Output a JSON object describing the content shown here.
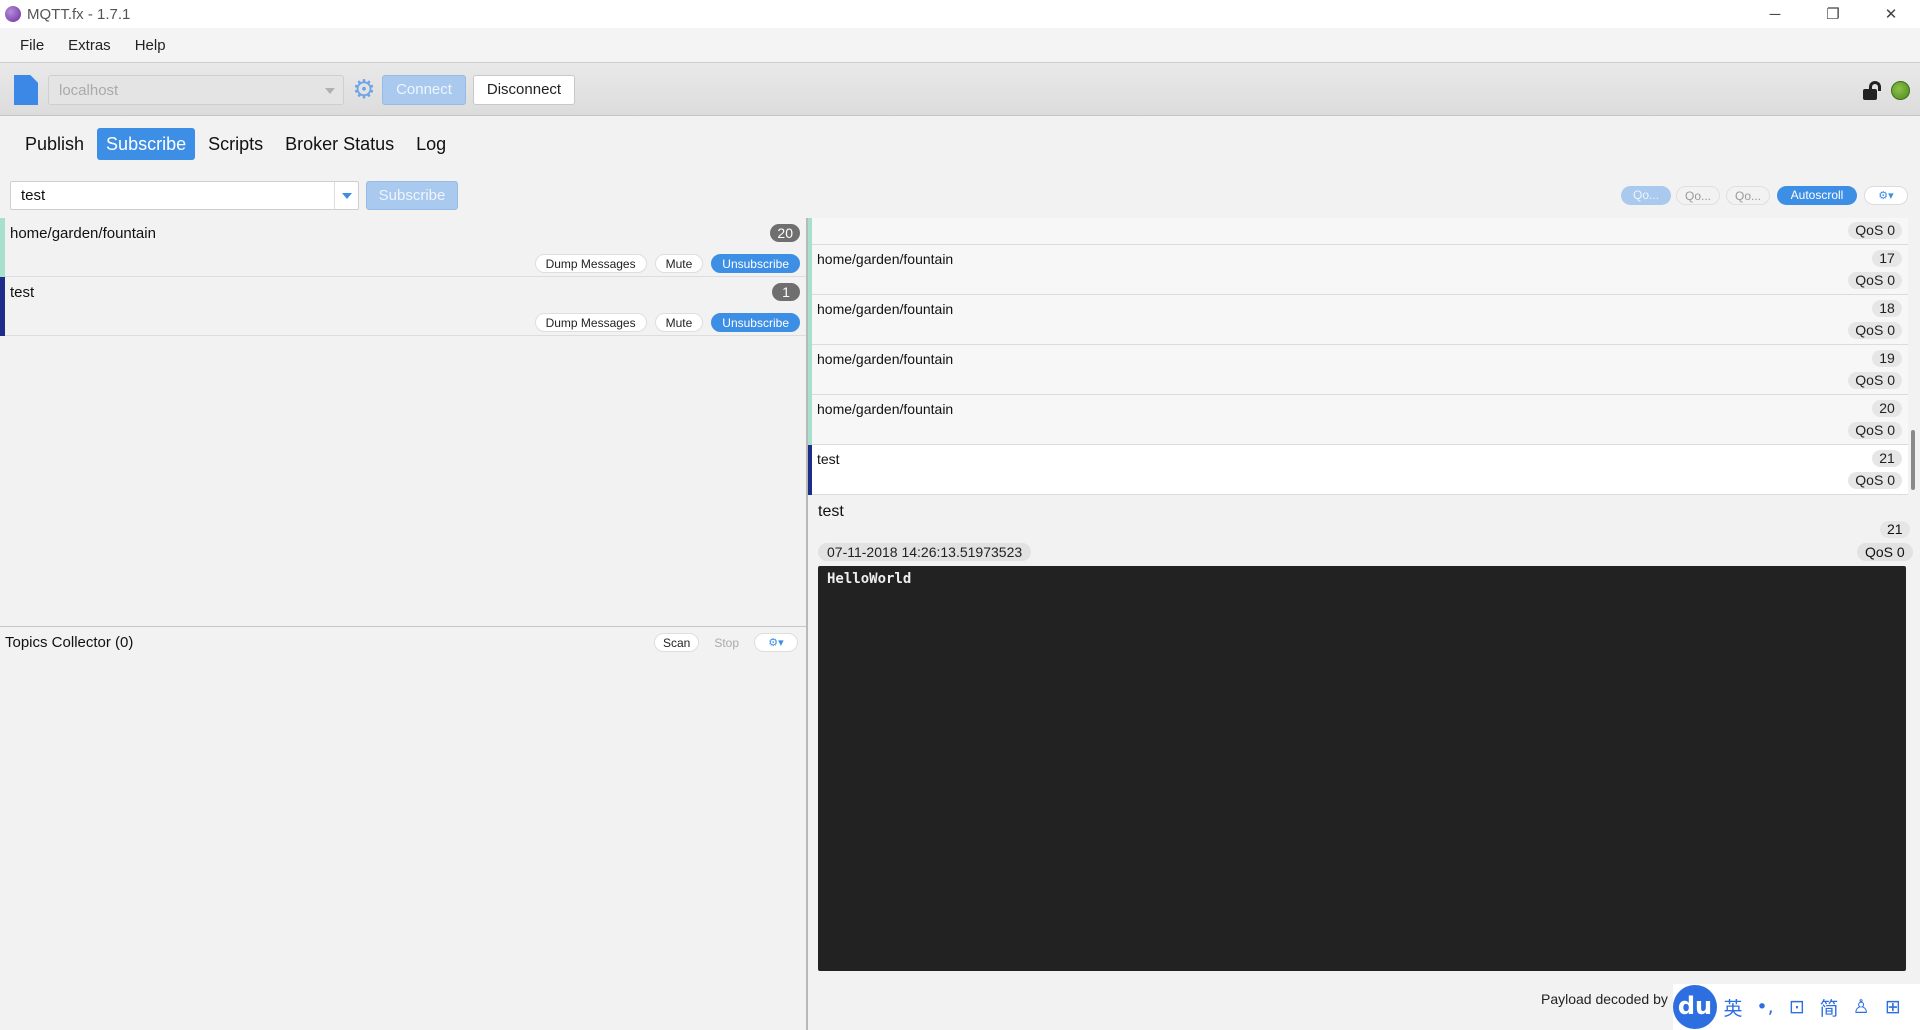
{
  "window": {
    "title": "MQTT.fx - 1.7.1",
    "minimize_glyph": "─",
    "restore_glyph": "❐",
    "close_glyph": "✕"
  },
  "menu": [
    "File",
    "Extras",
    "Help"
  ],
  "toolbar": {
    "broker_profile": "localhost",
    "connect_label": "Connect",
    "disconnect_label": "Disconnect",
    "gear_glyph": "⚙",
    "status_color": "#6aa332"
  },
  "tabs": [
    {
      "label": "Publish",
      "active": false
    },
    {
      "label": "Subscribe",
      "active": true
    },
    {
      "label": "Scripts",
      "active": false
    },
    {
      "label": "Broker Status",
      "active": false
    },
    {
      "label": "Log",
      "active": false
    }
  ],
  "subscribe": {
    "topic_value": "test",
    "subscribe_label": "Subscribe"
  },
  "qos_filters": [
    "Qo...",
    "Qo...",
    "Qo..."
  ],
  "autoscroll_label": "Autoscroll",
  "gears_glyph": "⚙▾",
  "subscriptions": [
    {
      "topic": "home/garden/fountain",
      "count": "20",
      "color": "#a8e0cf",
      "dump": "Dump Messages",
      "mute": "Mute",
      "unsubscribe": "Unsubscribe"
    },
    {
      "topic": "test",
      "count": "1",
      "color": "#1f2d8a",
      "dump": "Dump Messages",
      "mute": "Mute",
      "unsubscribe": "Unsubscribe"
    }
  ],
  "topics_collector": {
    "title": "Topics Collector (0)",
    "scan": "Scan",
    "stop": "Stop",
    "gear_glyph": "⚙▾"
  },
  "messages": [
    {
      "topic": "",
      "num": "",
      "qos": "QoS 0",
      "color": "#a8e0cf"
    },
    {
      "topic": "home/garden/fountain",
      "num": "17",
      "qos": "QoS 0",
      "color": "#a8e0cf"
    },
    {
      "topic": "home/garden/fountain",
      "num": "18",
      "qos": "QoS 0",
      "color": "#a8e0cf"
    },
    {
      "topic": "home/garden/fountain",
      "num": "19",
      "qos": "QoS 0",
      "color": "#a8e0cf"
    },
    {
      "topic": "home/garden/fountain",
      "num": "20",
      "qos": "QoS 0",
      "color": "#a8e0cf"
    },
    {
      "topic": "test",
      "num": "21",
      "qos": "QoS 0",
      "color": "#1f2d8a"
    }
  ],
  "detail": {
    "topic": "test",
    "num": "21",
    "timestamp": "07-11-2018  14:26:13.51973523",
    "qos": "QoS 0",
    "payload": "HelloWorld"
  },
  "decoded_label": "Payload decoded by",
  "ime": {
    "logo": "du",
    "items": [
      "英",
      "•,",
      "⊡",
      "简",
      "♙",
      "⊞"
    ]
  }
}
